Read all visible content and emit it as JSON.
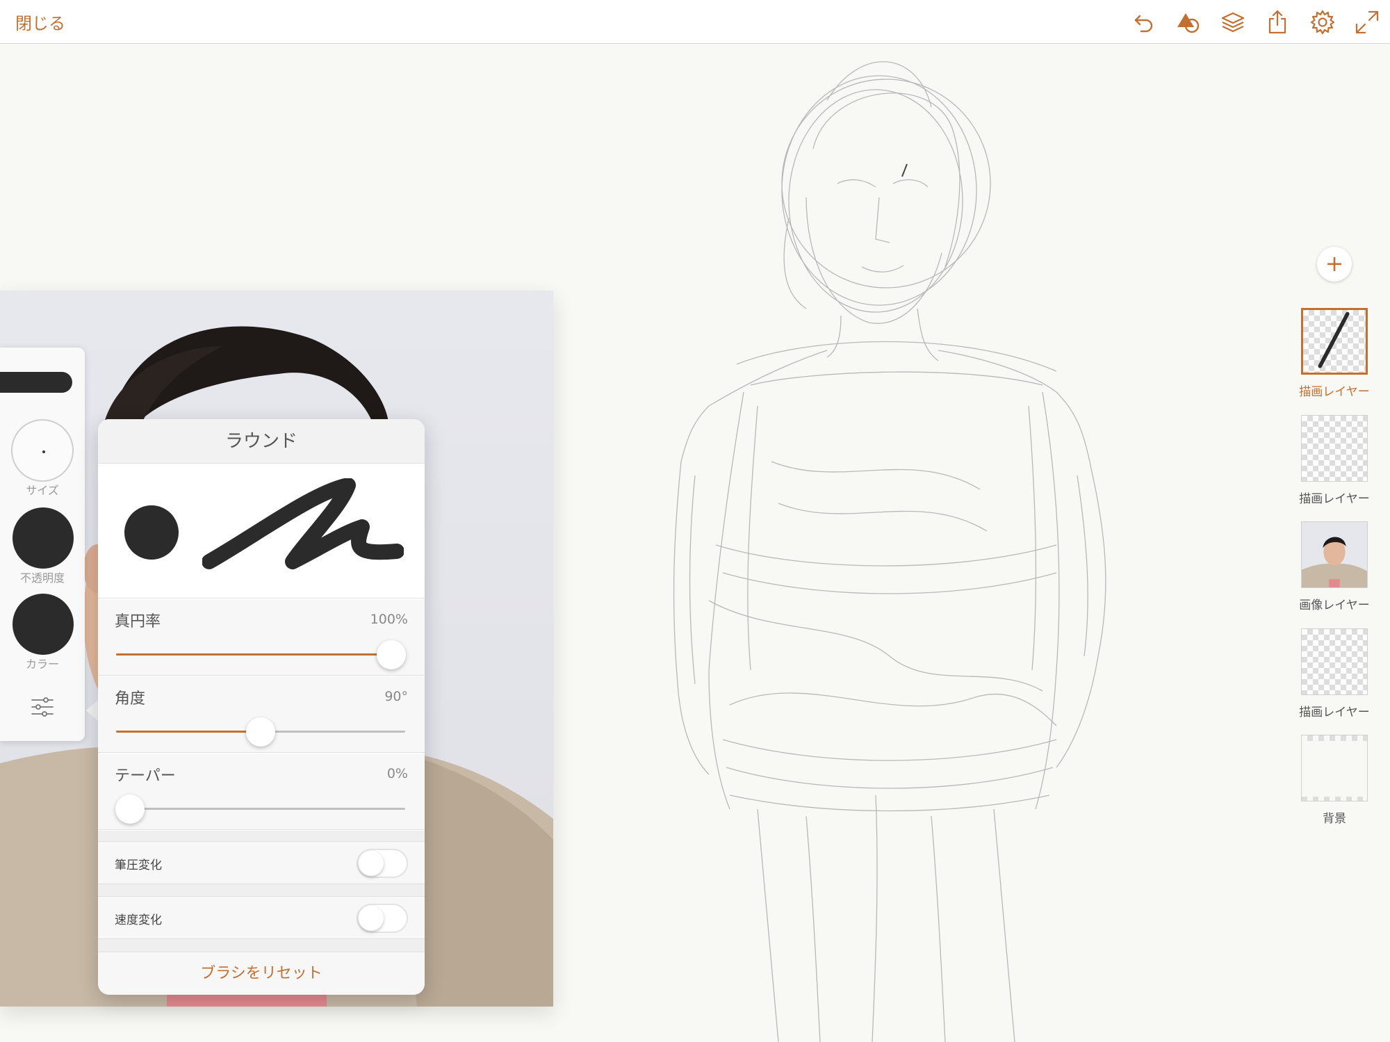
{
  "topbar": {
    "close_label": "閉じる",
    "icons": [
      "undo-icon",
      "shapes-icon",
      "layers-icon",
      "share-icon",
      "settings-icon",
      "fullscreen-icon"
    ]
  },
  "brush_panel": {
    "size_label": "サイズ",
    "opacity_label": "不透明度",
    "color_label": "カラー",
    "brush_color": "#2b2b2b"
  },
  "brush_settings": {
    "title": "ラウンド",
    "sliders": [
      {
        "label": "真円率",
        "value_text": "100%",
        "value": 1.0
      },
      {
        "label": "角度",
        "value_text": "90°",
        "value": 0.5
      },
      {
        "label": "テーパー",
        "value_text": "0%",
        "value": 0.0
      }
    ],
    "toggles": [
      {
        "label": "筆圧変化",
        "on": false
      },
      {
        "label": "速度変化",
        "on": false
      }
    ],
    "reset_label": "ブラシをリセット"
  },
  "layers": [
    {
      "label": "描画レイヤー",
      "type": "drawing",
      "active": true
    },
    {
      "label": "描画レイヤー",
      "type": "drawing",
      "active": false
    },
    {
      "label": "画像レイヤー",
      "type": "image",
      "active": false
    },
    {
      "label": "描画レイヤー",
      "type": "drawing",
      "active": false
    },
    {
      "label": "背景",
      "type": "background",
      "active": false
    }
  ],
  "colors": {
    "accent": "#c27032",
    "canvas": "#f8f8f4",
    "ink": "#2b2b2b"
  }
}
